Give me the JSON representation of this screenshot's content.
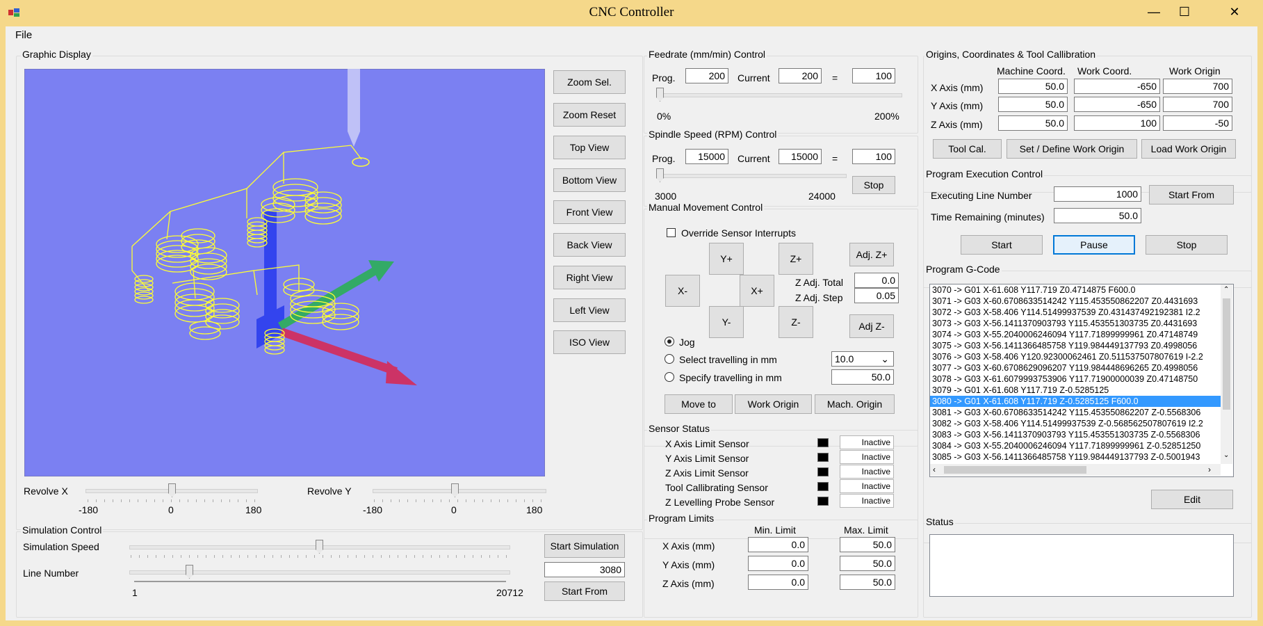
{
  "window": {
    "title": "CNC Controller",
    "minimize": "—",
    "maximize": "☐",
    "close": "✕"
  },
  "menu": {
    "file": "File"
  },
  "graphic": {
    "label": "Graphic Display",
    "views": [
      "Zoom Sel.",
      "Zoom Reset",
      "Top View",
      "Bottom View",
      "Front View",
      "Back View",
      "Right View",
      "Left View",
      "ISO View"
    ],
    "revolve_x": {
      "label": "Revolve X",
      "min": "-180",
      "mid": "0",
      "max": "180",
      "value": 0
    },
    "revolve_y": {
      "label": "Revolve Y",
      "min": "-180",
      "mid": "0",
      "max": "180",
      "value": 0
    },
    "colors": {
      "background": "#7b80f2",
      "toolpath": "#ffff33",
      "x_axis": "#cc3366",
      "y_axis": "#33aa66",
      "z_axis": "#3344ee"
    }
  },
  "simulation": {
    "label": "Simulation Control",
    "speed_label": "Simulation Speed",
    "line_label": "Line Number",
    "line_min": "1",
    "line_max": "20712",
    "line_value": "3080",
    "start_sim": "Start Simulation",
    "start_from": "Start From"
  },
  "feedrate": {
    "label": "Feedrate (mm/min) Control",
    "prog_label": "Prog.",
    "prog": "200",
    "current_label": "Current",
    "current": "200",
    "eq": "=",
    "percent": "100",
    "min": "0%",
    "max": "200%"
  },
  "spindle": {
    "label": "Spindle Speed (RPM) Control",
    "prog_label": "Prog.",
    "prog": "15000",
    "current_label": "Current",
    "current": "15000",
    "eq": "=",
    "percent": "100",
    "min": "3000",
    "max": "24000",
    "stop": "Stop"
  },
  "manual": {
    "label": "Manual Movement Control",
    "override": "Override Sensor Interrupts",
    "yplus": "Y+",
    "yminus": "Y-",
    "xplus": "X+",
    "xminus": "X-",
    "zplus": "Z+",
    "zminus": "Z-",
    "adjzplus": "Adj. Z+",
    "adjzminus": "Adj Z-",
    "zadj_total_label": "Z Adj. Total",
    "zadj_total": "0.0",
    "zadj_step_label": "Z Adj. Step",
    "zadj_step": "0.05",
    "jog": "Jog",
    "select_travel": "Select travelling in mm",
    "select_value": "10.0",
    "specify_travel": "Specify travelling in mm",
    "specify_value": "50.0",
    "move_to": "Move to",
    "work_origin": "Work Origin",
    "mach_origin": "Mach. Origin"
  },
  "sensors": {
    "label": "Sensor Status",
    "items": [
      {
        "name": "X Axis Limit Sensor",
        "state": "Inactive"
      },
      {
        "name": "Y Axis Limit Sensor",
        "state": "Inactive"
      },
      {
        "name": "Z Axis Limit Sensor",
        "state": "Inactive"
      },
      {
        "name": "Tool Callibrating Sensor",
        "state": "Inactive"
      },
      {
        "name": "Z Levelling Probe Sensor",
        "state": "Inactive"
      }
    ]
  },
  "limits": {
    "label": "Program Limits",
    "min_header": "Min. Limit",
    "max_header": "Max. Limit",
    "rows": [
      {
        "axis": "X Axis (mm)",
        "min": "0.0",
        "max": "50.0"
      },
      {
        "axis": "Y Axis (mm)",
        "min": "0.0",
        "max": "50.0"
      },
      {
        "axis": "Z Axis (mm)",
        "min": "0.0",
        "max": "50.0"
      }
    ]
  },
  "origins": {
    "label": "Origins, Coordinates & Tool Callibration",
    "machine_header": "Machine Coord.",
    "work_header": "Work Coord.",
    "origin_header": "Work Origin",
    "rows": [
      {
        "axis": "X Axis (mm)",
        "machine": "50.0",
        "work": "-650",
        "origin": "700"
      },
      {
        "axis": "Y Axis (mm)",
        "machine": "50.0",
        "work": "-650",
        "origin": "700"
      },
      {
        "axis": "Z Axis (mm)",
        "machine": "50.0",
        "work": "100",
        "origin": "-50"
      }
    ],
    "tool_cal": "Tool Cal.",
    "set_origin": "Set / Define Work Origin",
    "load_origin": "Load Work Origin"
  },
  "execution": {
    "label": "Program Execution Control",
    "line_label": "Executing Line Number",
    "line": "1000",
    "time_label": "Time Remaining (minutes)",
    "time": "50.0",
    "start_from": "Start From",
    "start": "Start",
    "pause": "Pause",
    "stop": "Stop"
  },
  "gcode": {
    "label": "Program G-Code",
    "selected_index": 10,
    "lines": [
      "3070  ->   G01 X-61.608 Y117.719 Z0.4714875 F600.0",
      "3071  ->   G03 X-60.6708633514242 Y115.453550862207 Z0.4431693",
      "3072  ->   G03 X-58.406 Y114.51499937539 Z0.431437492192381 I2.2",
      "3073  ->   G03 X-56.1411370903793 Y115.453551303735 Z0.4431693",
      "3074  ->   G03 X-55.2040006246094 Y117.71899999961 Z0.47148749",
      "3075  ->   G03 X-56.1411366485758 Y119.984449137793 Z0.4998056",
      "3076  ->   G03 X-58.406 Y120.92300062461 Z0.511537507807619 I-2.2",
      "3077  ->   G03 X-60.6708629096207 Y119.984448696265 Z0.4998056",
      "3078  ->   G03 X-61.6079993753906 Y117.71900000039 Z0.47148750",
      "3079  ->   G01 X-61.608 Y117.719 Z-0.5285125",
      "3080  ->   G01 X-61.608 Y117.719 Z-0.5285125 F600.0",
      "3081  ->   G03 X-60.6708633514242 Y115.453550862207 Z-0.5568306",
      "3082  ->   G03 X-58.406 Y114.51499937539 Z-0.568562507807619 I2.2",
      "3083  ->   G03 X-56.1411370903793 Y115.453551303735 Z-0.5568306",
      "3084  ->   G03 X-55.2040006246094 Y117.71899999961 Z-0.52851250",
      "3085  ->   G03 X-56.1411366485758 Y119.984449137793 Z-0.5001943"
    ],
    "edit": "Edit"
  },
  "status": {
    "label": "Status",
    "text": ""
  }
}
